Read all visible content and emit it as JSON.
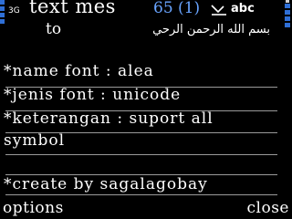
{
  "status": {
    "network": "3G",
    "mode": "abc"
  },
  "header": {
    "title": "text mes",
    "counter": "65 (1)"
  },
  "recipient": {
    "label": "to",
    "value": "بسم الله الرحمن الرحي"
  },
  "message": {
    "lines": [
      "*name font : alea",
      "*jenis font : unicode",
      "*keterangan : suport all",
      "symbol",
      "",
      "*create by sagalagobay"
    ]
  },
  "softkeys": {
    "left": "options",
    "right": "close"
  },
  "colors": {
    "accent": "#2f6fd6",
    "counter": "#69a4ff",
    "background": "#000000",
    "text": "#ffffff",
    "rule": "#9a9a9a"
  }
}
